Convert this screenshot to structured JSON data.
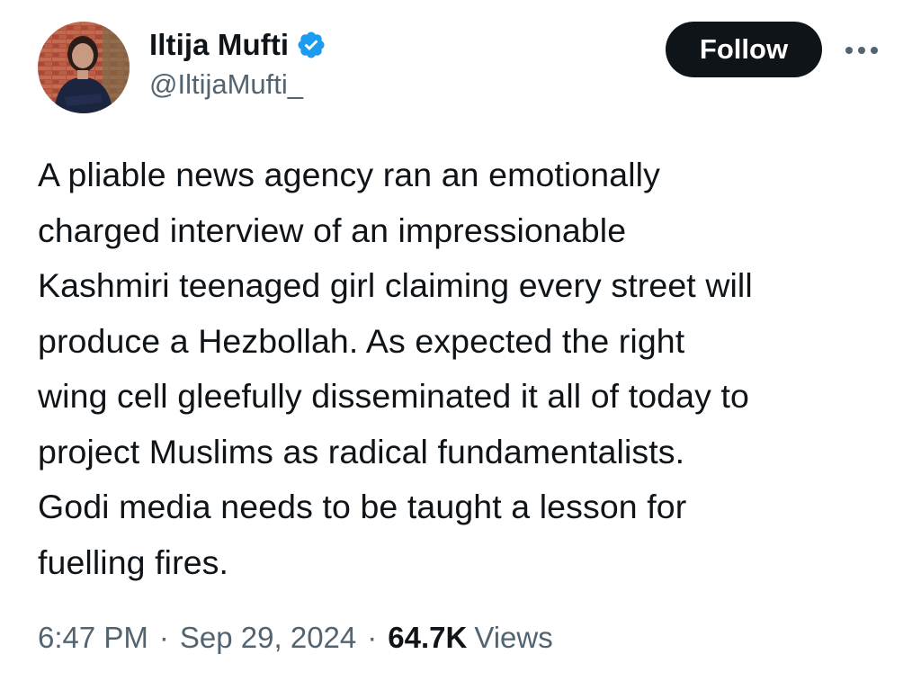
{
  "author": {
    "display_name": "Iltija Mufti",
    "handle": "@IltijaMufti_",
    "verified": true,
    "verified_badge_color": "#1d9bf0"
  },
  "actions": {
    "follow_label": "Follow",
    "more_icon": "more-horizontal-icon"
  },
  "tweet": {
    "text": "A pliable news agency ran an emotionally\ncharged interview of an impressionable\nKashmiri teenaged girl claiming every street will\nproduce a Hezbollah. As expected the right\nwing cell gleefully disseminated it all of today to\nproject Muslims as radical fundamentalists.\nGodi media needs to be taught a lesson for\nfuelling fires."
  },
  "meta": {
    "time": "6:47 PM",
    "date": "Sep 29, 2024",
    "separator": "·",
    "views_count": "64.7K",
    "views_label": "Views"
  },
  "colors": {
    "text_primary": "#0f1419",
    "text_secondary": "#536471",
    "follow_bg": "#0f1419",
    "follow_text": "#ffffff",
    "background": "#ffffff"
  }
}
